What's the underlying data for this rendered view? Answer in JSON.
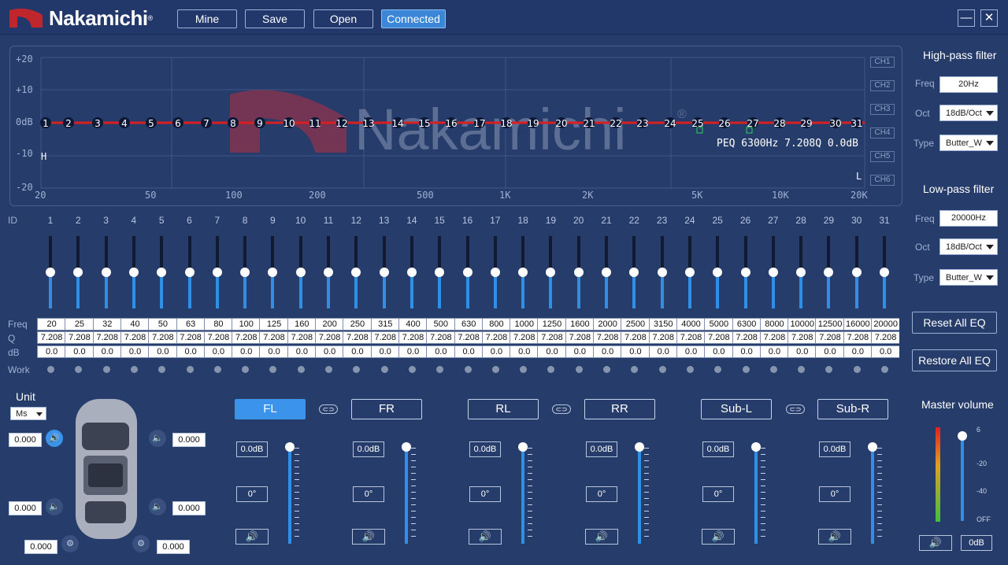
{
  "top": {
    "brand": "Nakamichi",
    "buttons": [
      "Mine",
      "Save",
      "Open",
      "Connected"
    ],
    "minimize": "—",
    "close": "✕"
  },
  "graph": {
    "y_labels": [
      "+20",
      "+10",
      "0dB",
      "-10",
      "-20"
    ],
    "x_labels": [
      "20",
      "50",
      "100",
      "200",
      "500",
      "1K",
      "2K",
      "5K",
      "10K",
      "20K"
    ],
    "channels": [
      "CH1",
      "CH2",
      "CH3",
      "CH4",
      "CH5",
      "CH6"
    ],
    "point_ids": [
      "1",
      "2",
      "3",
      "4",
      "5",
      "6",
      "7",
      "8",
      "9",
      "10",
      "11",
      "12",
      "13",
      "14",
      "15",
      "16",
      "17",
      "18",
      "19",
      "20",
      "21",
      "22",
      "23",
      "24",
      "25",
      "26",
      "27",
      "28",
      "29",
      "30",
      "31"
    ],
    "info": "PEQ 6300Hz 7.208Q 0.0dB",
    "watermark": "Nakamichi",
    "h_marker": "H",
    "l_marker": "L"
  },
  "hpf": {
    "title": "High-pass filter",
    "freq_label": "Freq",
    "freq": "20Hz",
    "oct_label": "Oct",
    "oct": "18dB/Oct",
    "type_label": "Type",
    "type": "Butter_W"
  },
  "lpf": {
    "title": "Low-pass filter",
    "freq_label": "Freq",
    "freq": "20000Hz",
    "oct_label": "Oct",
    "oct": "18dB/Oct",
    "type_label": "Type",
    "type": "Butter_W"
  },
  "reset_all": "Reset All EQ",
  "restore_all": "Restore All EQ",
  "eq": {
    "id_label": "ID",
    "freq_label": "Freq",
    "q_label": "Q",
    "db_label": "dB",
    "work_label": "Work",
    "ids": [
      "1",
      "2",
      "3",
      "4",
      "5",
      "6",
      "7",
      "8",
      "9",
      "10",
      "11",
      "12",
      "13",
      "14",
      "15",
      "16",
      "17",
      "18",
      "19",
      "20",
      "21",
      "22",
      "23",
      "24",
      "25",
      "26",
      "27",
      "28",
      "29",
      "30",
      "31"
    ],
    "freqs": [
      "20",
      "25",
      "32",
      "40",
      "50",
      "63",
      "80",
      "100",
      "125",
      "160",
      "200",
      "250",
      "315",
      "400",
      "500",
      "630",
      "800",
      "1000",
      "1250",
      "1600",
      "2000",
      "2500",
      "3150",
      "4000",
      "5000",
      "6300",
      "8000",
      "10000",
      "12500",
      "16000",
      "20000"
    ],
    "q": [
      "7.208",
      "7.208",
      "7.208",
      "7.208",
      "7.208",
      "7.208",
      "7.208",
      "7.208",
      "7.208",
      "7.208",
      "7.208",
      "7.208",
      "7.208",
      "7.208",
      "7.208",
      "7.208",
      "7.208",
      "7.208",
      "7.208",
      "7.208",
      "7.208",
      "7.208",
      "7.208",
      "7.208",
      "7.208",
      "7.208",
      "7.208",
      "7.208",
      "7.208",
      "7.208",
      "7.208"
    ],
    "db": [
      "0.0",
      "0.0",
      "0.0",
      "0.0",
      "0.0",
      "0.0",
      "0.0",
      "0.0",
      "0.0",
      "0.0",
      "0.0",
      "0.0",
      "0.0",
      "0.0",
      "0.0",
      "0.0",
      "0.0",
      "0.0",
      "0.0",
      "0.0",
      "0.0",
      "0.0",
      "0.0",
      "0.0",
      "0.0",
      "0.0",
      "0.0",
      "0.0",
      "0.0",
      "0.0",
      "0.0"
    ],
    "gain_level": 0.5
  },
  "unit": {
    "label": "Unit",
    "value": "Ms",
    "delays": [
      "0.000",
      "0.000",
      "0.000",
      "0.000",
      "0.000",
      "0.000"
    ]
  },
  "channels": [
    {
      "name": "FL",
      "gain": "0.0dB",
      "phase": "0°",
      "mute": "🔊",
      "active": true
    },
    {
      "name": "FR",
      "gain": "0.0dB",
      "phase": "0°",
      "mute": "🔊",
      "active": false
    },
    {
      "name": "RL",
      "gain": "0.0dB",
      "phase": "0°",
      "mute": "🔊",
      "active": false
    },
    {
      "name": "RR",
      "gain": "0.0dB",
      "phase": "0°",
      "mute": "🔊",
      "active": false
    },
    {
      "name": "Sub-L",
      "gain": "0.0dB",
      "phase": "0°",
      "mute": "🔊",
      "active": false
    },
    {
      "name": "Sub-R",
      "gain": "0.0dB",
      "phase": "0°",
      "mute": "🔊",
      "active": false
    }
  ],
  "link_icon": "⊂⊃",
  "master": {
    "title": "Master volume",
    "scale": [
      "6",
      "-20",
      "-40",
      "OFF"
    ],
    "value": "0dB",
    "mute": "🔊",
    "level": 0.95
  },
  "colors": {
    "background": "#263c6a",
    "accent": "#3b93ea",
    "curve": "#d92020",
    "brand_red": "#c0272d"
  }
}
